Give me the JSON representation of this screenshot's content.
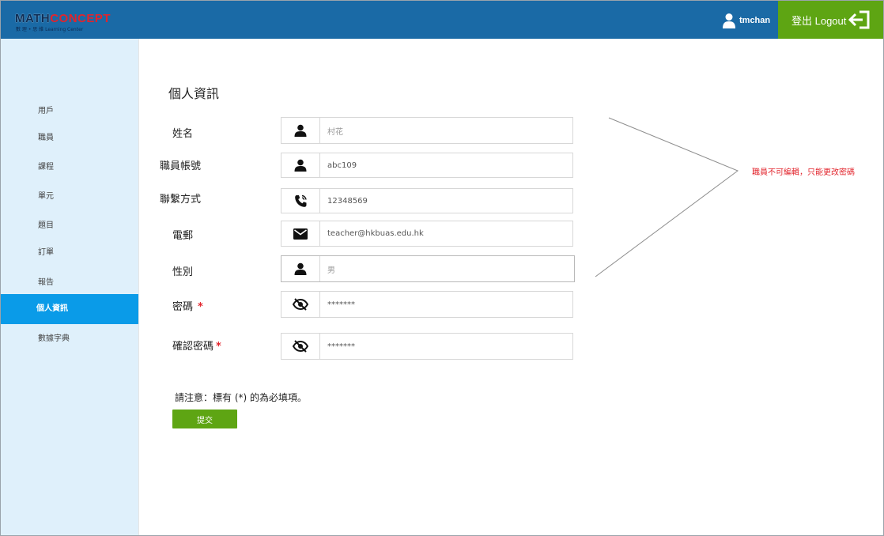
{
  "header": {
    "logo": {
      "main_a": "MATH",
      "main_b": "CONCEPT",
      "sub": "數 理 • 思 維 Learning Center"
    },
    "username": "tmchan",
    "logout_label": "登出 Logout"
  },
  "sidebar": {
    "items": [
      {
        "label": "用戶"
      },
      {
        "label": "職員"
      },
      {
        "label": "課程"
      },
      {
        "label": "單元"
      },
      {
        "label": "題目"
      },
      {
        "label": "訂單"
      },
      {
        "label": "報告"
      },
      {
        "label": "個人資訊",
        "active": true
      },
      {
        "label": "數據字典"
      }
    ]
  },
  "main": {
    "title": "個人資訊",
    "fields": [
      {
        "label": "姓名",
        "value": "村花",
        "icon": "user-icon"
      },
      {
        "label": "職員帳號",
        "value": "abc109",
        "icon": "user-icon"
      },
      {
        "label": "聯繫方式",
        "value": "12348569",
        "icon": "phone-icon"
      },
      {
        "label": "電郵",
        "value": "teacher@hkbuas.edu.hk",
        "icon": "mail-icon"
      },
      {
        "label": "性別",
        "value": "男",
        "icon": "user-icon"
      },
      {
        "label": "密碼",
        "value": "*******",
        "icon": "eye-off-icon",
        "required": "*"
      },
      {
        "label": "確認密碼",
        "value": "*******",
        "icon": "eye-off-icon",
        "required": "*"
      }
    ],
    "note": "請注意：標有 (*) 的為必填項。",
    "submit_label": "提交"
  },
  "annotation": {
    "text": "職員不可編輯，只能更改密碼"
  },
  "colors": {
    "header": "#1a6aa6",
    "accent_green": "#5ea513",
    "sidebar_bg": "#dff0fb",
    "sidebar_active": "#0a9be8",
    "required": "#e2242c"
  }
}
